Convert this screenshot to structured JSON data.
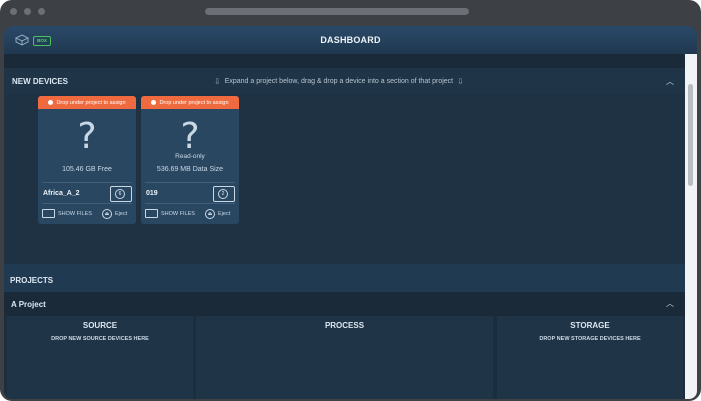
{
  "header": {
    "title": "DASHBOARD",
    "badge": "BOX",
    "logo_icon": "cube-icon"
  },
  "new_devices": {
    "title": "NEW DEVICES",
    "instruction": "Expand a project below, drag & drop a device into a section of that project",
    "devices": [
      {
        "warning": "Drop under project to assign",
        "symbol": "?",
        "status": "",
        "info": "105.46 GB Free",
        "name": "Africa_A_2",
        "drive_number": "6",
        "show_files": "SHOW FILES",
        "eject": "Eject"
      },
      {
        "warning": "Drop under project to assign",
        "symbol": "?",
        "status": "Read-only",
        "info": "536.69 MB Data Size",
        "name": "019",
        "drive_number": "2",
        "show_files": "SHOW FILES",
        "eject": "Eject"
      }
    ]
  },
  "projects": {
    "title": "PROJECTS",
    "project_name": "A Project",
    "sections": [
      {
        "title": "SOURCE",
        "hint": "DROP NEW SOURCE DEVICES HERE"
      },
      {
        "title": "PROCESS",
        "hint": ""
      },
      {
        "title": "STORAGE",
        "hint": "DROP NEW STORAGE DEVICES HERE"
      }
    ]
  },
  "colors": {
    "accent_warning": "#f06a3f",
    "badge_green": "#52d466",
    "panel": "#2a4762"
  }
}
